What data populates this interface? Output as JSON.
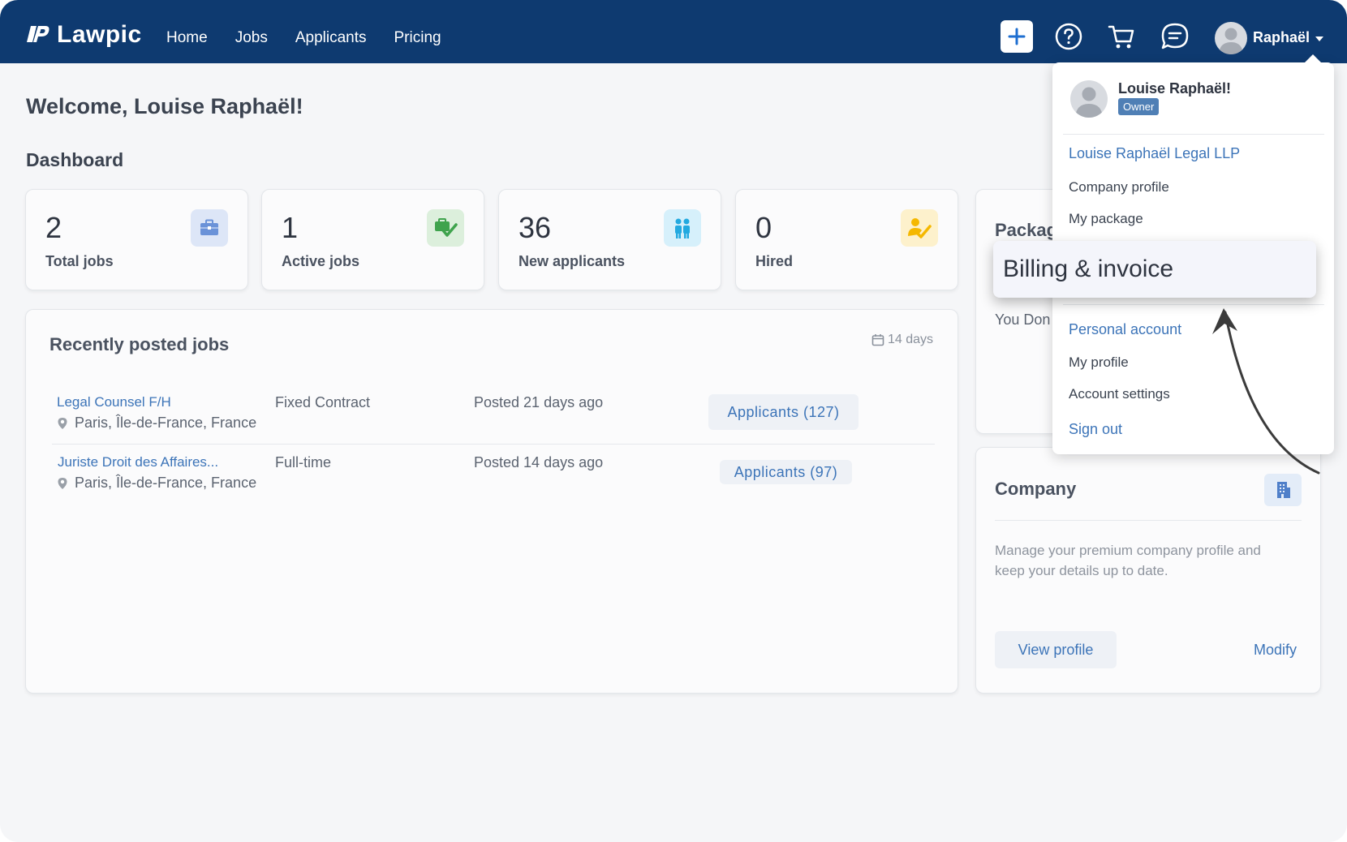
{
  "brand": {
    "name": "Lawpic"
  },
  "nav": {
    "links": [
      "Home",
      "Jobs",
      "Applicants",
      "Pricing"
    ],
    "user_label": "Raphaël"
  },
  "page": {
    "welcome": "Welcome, Louise Raphaël!",
    "dashboard_title": "Dashboard"
  },
  "stats": [
    {
      "value": "2",
      "label": "Total jobs",
      "icon": "briefcase-icon",
      "color": "#6a92d8"
    },
    {
      "value": "1",
      "label": "Active jobs",
      "icon": "briefcase-check-icon",
      "color": "#3fa34d"
    },
    {
      "value": "36",
      "label": "New applicants",
      "icon": "people-icon",
      "color": "#22a9e0"
    },
    {
      "value": "0",
      "label": "Hired",
      "icon": "user-check-icon",
      "color": "#f5b800"
    }
  ],
  "jobs": {
    "title": "Recently posted jobs",
    "range": "14 days",
    "rows": [
      {
        "title": "Legal Counsel F/H",
        "location": "Paris, Île-de-France, France",
        "type": "Fixed Contract",
        "posted": "Posted 21 days ago",
        "applicants": "Applicants  (127)"
      },
      {
        "title": "Juriste Droit des Affaires...",
        "location": "Paris, Île-de-France, France",
        "type": "Full-time",
        "posted": "Posted 14 days ago",
        "applicants": "Applicants  (97)"
      }
    ]
  },
  "package_card": {
    "title_partial": "Packag",
    "text_partial": "You Don"
  },
  "company_card": {
    "title": "Company",
    "description": "Manage your premium company profile and keep your details up to date.",
    "view_label": "View profile",
    "modify_label": "Modify"
  },
  "dropdown": {
    "name": "Louise Raphaël!",
    "role": "Owner",
    "company_link": "Louise Raphaël Legal LLP",
    "company_profile": "Company profile",
    "my_package": "My package",
    "billing": "Billing & invoice",
    "personal_account": "Personal account",
    "my_profile": "My profile",
    "account_settings": "Account settings",
    "sign_out": "Sign out"
  },
  "colors": {
    "navbar": "#0e3a70",
    "link": "#3c74b8",
    "badge": "#4f7fb5"
  }
}
